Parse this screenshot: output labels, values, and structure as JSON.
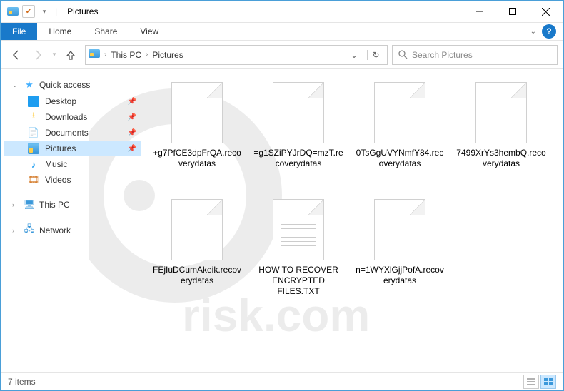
{
  "titlebar": {
    "title": "Pictures",
    "separator": "|"
  },
  "ribbon": {
    "file": "File",
    "tabs": [
      "Home",
      "Share",
      "View"
    ]
  },
  "nav": {
    "breadcrumbs": [
      "This PC",
      "Pictures"
    ],
    "search_placeholder": "Search Pictures"
  },
  "sidebar": {
    "quick_access": {
      "label": "Quick access",
      "items": [
        {
          "label": "Desktop",
          "icon": "desktop",
          "pinned": true
        },
        {
          "label": "Downloads",
          "icon": "folder",
          "pinned": true
        },
        {
          "label": "Documents",
          "icon": "doc",
          "pinned": true
        },
        {
          "label": "Pictures",
          "icon": "pic",
          "pinned": true,
          "selected": true
        },
        {
          "label": "Music",
          "icon": "music",
          "pinned": false
        },
        {
          "label": "Videos",
          "icon": "video",
          "pinned": false
        }
      ]
    },
    "this_pc": {
      "label": "This PC"
    },
    "network": {
      "label": "Network"
    }
  },
  "files": [
    {
      "name": "+g7PfCE3dpFrQA.recoverydatas",
      "type": "file"
    },
    {
      "name": "=g1SZiPYJrDQ=mzT.recoverydatas",
      "type": "file"
    },
    {
      "name": "0TsGgUVYNmfY84.recoverydatas",
      "type": "file"
    },
    {
      "name": "7499XrYs3hembQ.recoverydatas",
      "type": "file"
    },
    {
      "name": "FEjIuDCumAkeik.recoverydatas",
      "type": "file"
    },
    {
      "name": "HOW TO RECOVER ENCRYPTED FILES.TXT",
      "type": "text"
    },
    {
      "name": "n=1WYXlGjjPofA.recoverydatas",
      "type": "file"
    }
  ],
  "status": {
    "count_label": "7 items"
  }
}
